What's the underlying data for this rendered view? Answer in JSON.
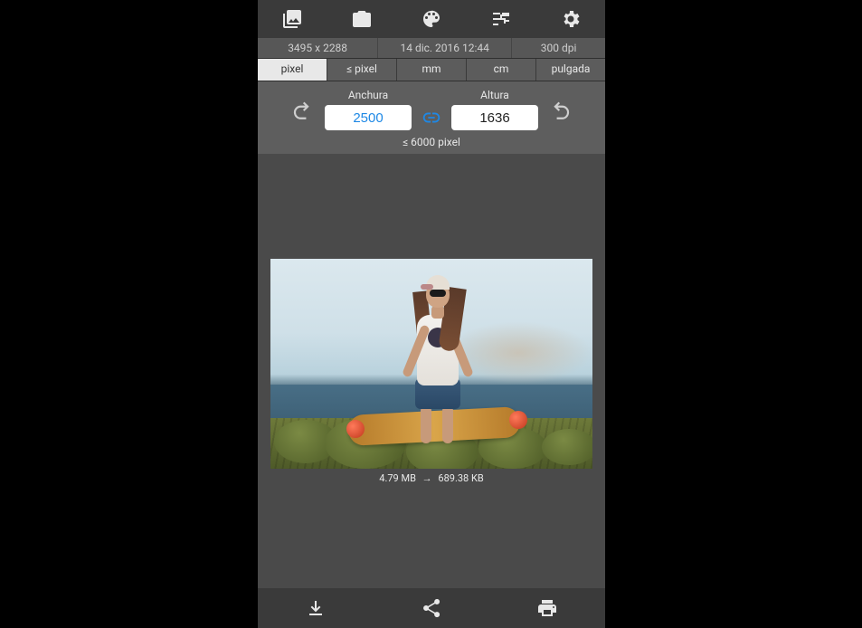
{
  "toolbar": {
    "icons": [
      "gallery-icon",
      "camera-icon",
      "palette-icon",
      "sliders-icon",
      "gear-icon"
    ]
  },
  "info": {
    "resolution": "3495 x 2288",
    "datetime": "14 dic. 2016 12:44",
    "dpi": "300 dpi"
  },
  "units": {
    "tabs": [
      "pixel",
      "≤ pixel",
      "mm",
      "cm",
      "pulgada"
    ],
    "active_index": 0
  },
  "dimensions": {
    "width_label": "Anchura",
    "height_label": "Altura",
    "width_value": "2500",
    "height_value": "1636",
    "limit_text": "≤ 6000 pixel",
    "link_locked": true
  },
  "filesize": {
    "original": "4.79 MB",
    "resized": "689.38 KB"
  },
  "bottom": {
    "icons": [
      "download-icon",
      "share-icon",
      "print-icon"
    ]
  }
}
